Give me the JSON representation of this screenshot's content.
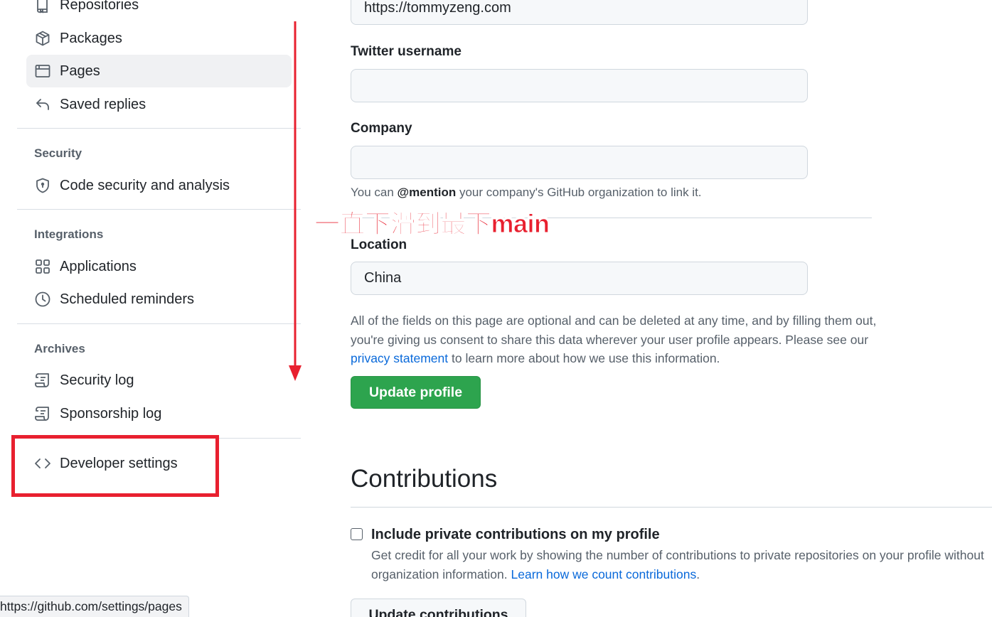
{
  "sidebar": {
    "items": [
      {
        "label": "Repositories",
        "icon": "repo-icon"
      },
      {
        "label": "Packages",
        "icon": "package-icon"
      },
      {
        "label": "Pages",
        "icon": "browser-icon",
        "active": true
      },
      {
        "label": "Saved replies",
        "icon": "reply-icon"
      },
      {
        "label": "Code security and analysis",
        "icon": "shield-icon"
      },
      {
        "label": "Applications",
        "icon": "apps-grid-icon"
      },
      {
        "label": "Scheduled reminders",
        "icon": "clock-icon"
      },
      {
        "label": "Security log",
        "icon": "log-icon"
      },
      {
        "label": "Sponsorship log",
        "icon": "log-icon"
      },
      {
        "label": "Developer settings",
        "icon": "code-icon"
      }
    ],
    "sections": {
      "security": "Security",
      "integrations": "Integrations",
      "archives": "Archives"
    }
  },
  "profile_form": {
    "url_value": "https://tommyzeng.com",
    "twitter_label": "Twitter username",
    "twitter_value": "",
    "company_label": "Company",
    "company_value": "",
    "company_note_prefix": "You can ",
    "company_note_mention": "@mention",
    "company_note_suffix": " your company's GitHub organization to link it.",
    "location_label": "Location",
    "location_value": "China",
    "info_text_1": "All of the fields on this page are optional and can be deleted at any time, and by filling them out, you're giving us consent to share this data wherever your user profile appears. Please see our ",
    "info_link": "privacy statement",
    "info_text_2": " to learn more about how we use this information.",
    "update_button": "Update profile"
  },
  "contributions": {
    "heading": "Contributions",
    "checkbox_label": "Include private contributions on my profile",
    "checkbox_checked": false,
    "desc_line1": "Get credit for all your work by showing the number of contributions to private repositories on your profile without",
    "desc_line2_prefix": "organization information. ",
    "desc_link": "Learn how we count contributions",
    "desc_line2_suffix": ".",
    "update_button": "Update contributions"
  },
  "annotation": {
    "text": "一直下滑到最下main",
    "color": "#e8202f"
  },
  "status_bar": {
    "url": "https://github.com/settings/pages"
  },
  "colors": {
    "accent_green": "#2da44e",
    "link_blue": "#0969da",
    "muted_text": "#57606a",
    "annotation_red": "#e8202f"
  }
}
